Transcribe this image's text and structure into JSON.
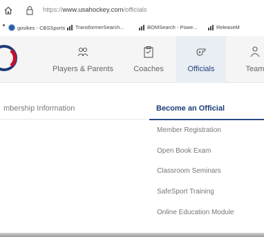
{
  "browser": {
    "url_prefix": "https://",
    "url_host": "www.usahockey.com",
    "url_path": "/officials"
  },
  "bookmarks": [
    {
      "label": "govikes - CBSSports",
      "icon": "globe-icon"
    },
    {
      "label": "TransformerSearch...",
      "icon": "bars-icon"
    },
    {
      "label": "BOMSearch - Powe...",
      "icon": "bars-icon"
    },
    {
      "label": "ReleaseM",
      "icon": "bars-icon"
    }
  ],
  "nav": {
    "items": [
      {
        "label": "Players & Parents",
        "icon": "people-icon"
      },
      {
        "label": "Coaches",
        "icon": "clipboard-icon"
      },
      {
        "label": "Officials",
        "icon": "whistle-icon",
        "active": true
      },
      {
        "label": "Team",
        "icon": "team-icon"
      }
    ]
  },
  "dropdown": {
    "left_link": "mbership Information",
    "section_title": "Become an Official",
    "links": [
      "Member Registration",
      "Open Book Exam",
      "Classroom Seminars",
      "SafeSport Training",
      "Online Education Module"
    ]
  },
  "colors": {
    "accent": "#1d3b78",
    "nav_bg": "#f5f5f5",
    "active_tab_bg": "#e9eef4",
    "logo_red": "#c8102e"
  }
}
